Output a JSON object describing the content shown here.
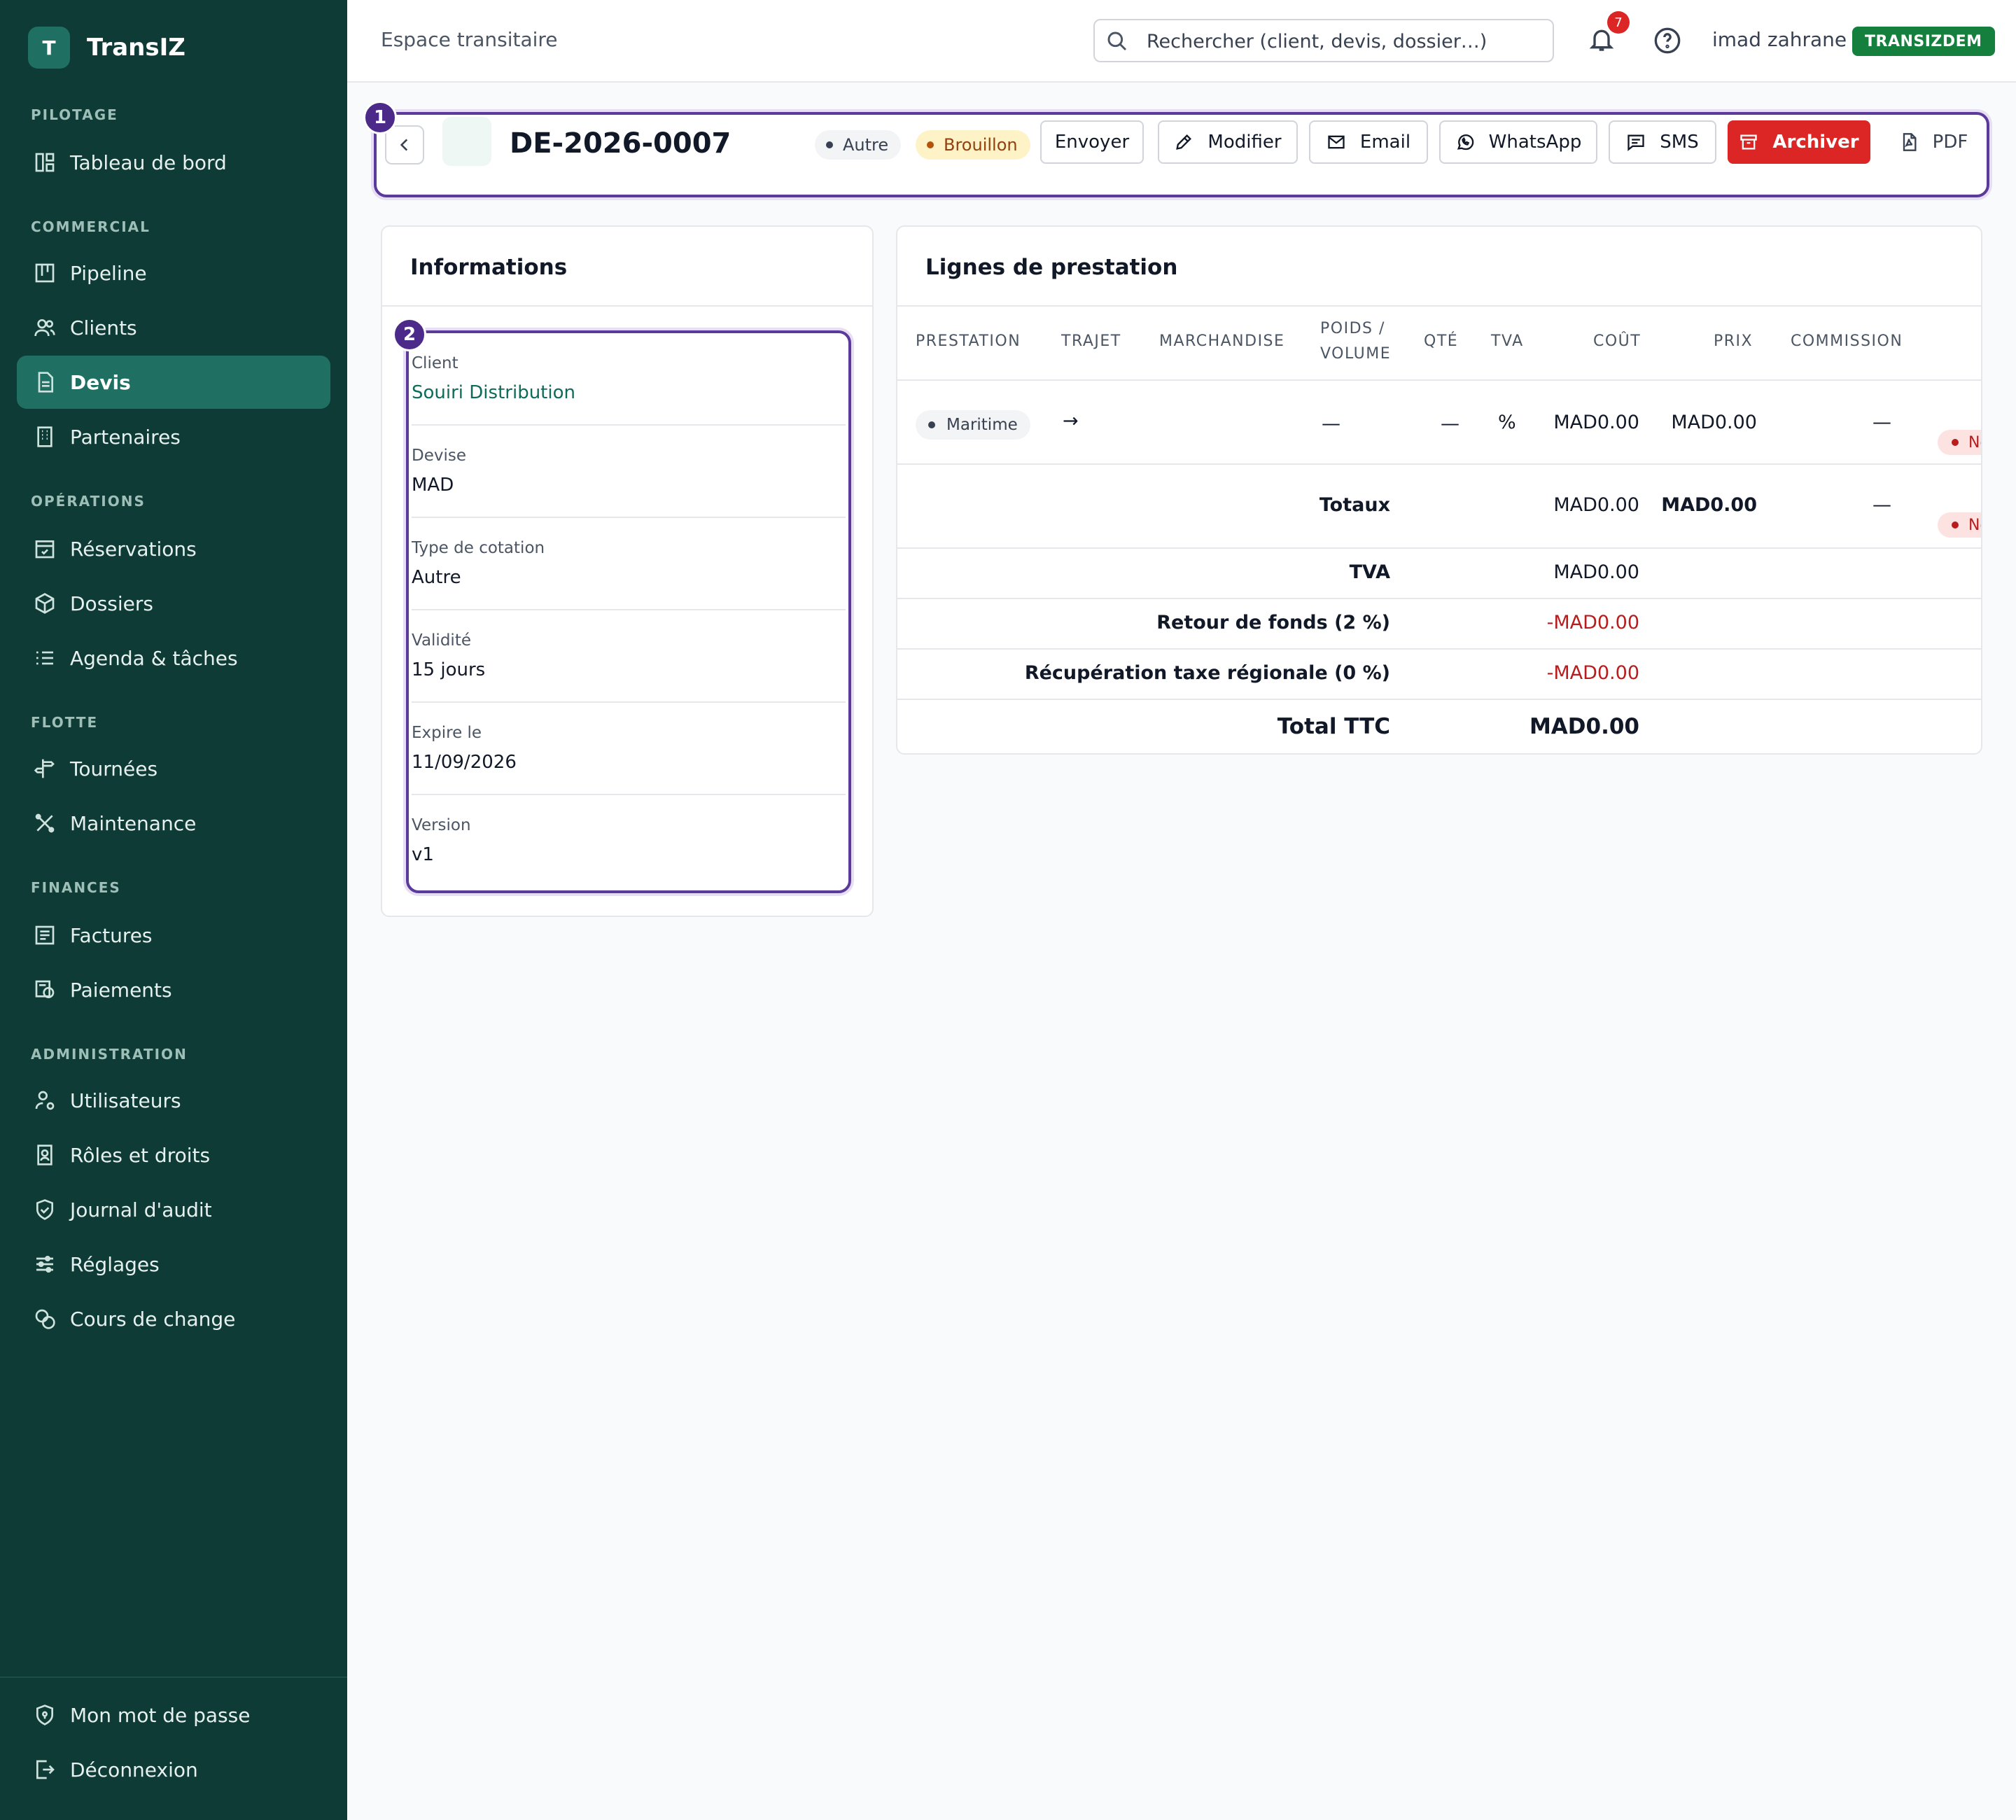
{
  "app": {
    "logo_letter": "T",
    "name": "TransIZ"
  },
  "sidebar": {
    "sections": [
      {
        "title": "PILOTAGE",
        "items": [
          {
            "label": "Tableau de bord",
            "icon": "dashboard-icon"
          }
        ]
      },
      {
        "title": "COMMERCIAL",
        "items": [
          {
            "label": "Pipeline",
            "icon": "kanban-icon"
          },
          {
            "label": "Clients",
            "icon": "users-icon"
          },
          {
            "label": "Devis",
            "icon": "document-icon",
            "active": true
          },
          {
            "label": "Partenaires",
            "icon": "building-icon"
          }
        ]
      },
      {
        "title": "OPÉRATIONS",
        "items": [
          {
            "label": "Réservations",
            "icon": "calendar-check-icon"
          },
          {
            "label": "Dossiers",
            "icon": "package-icon"
          },
          {
            "label": "Agenda & tâches",
            "icon": "list-icon"
          }
        ]
      },
      {
        "title": "FLOTTE",
        "items": [
          {
            "label": "Tournées",
            "icon": "signpost-icon"
          },
          {
            "label": "Maintenance",
            "icon": "tools-icon"
          }
        ]
      },
      {
        "title": "FINANCES",
        "items": [
          {
            "label": "Factures",
            "icon": "receipt-icon"
          },
          {
            "label": "Paiements",
            "icon": "payment-icon"
          }
        ]
      },
      {
        "title": "ADMINISTRATION",
        "items": [
          {
            "label": "Utilisateurs",
            "icon": "user-cog-icon"
          },
          {
            "label": "Rôles et droits",
            "icon": "id-badge-icon"
          },
          {
            "label": "Journal d'audit",
            "icon": "shield-check-icon"
          },
          {
            "label": "Réglages",
            "icon": "sliders-icon"
          },
          {
            "label": "Cours de change",
            "icon": "coins-icon"
          }
        ]
      }
    ],
    "footer": [
      {
        "label": "Mon mot de passe",
        "icon": "shield-lock-icon"
      },
      {
        "label": "Déconnexion",
        "icon": "logout-icon"
      }
    ]
  },
  "topbar": {
    "workspace": "Espace transitaire",
    "search_placeholder": "Rechercher (client, devis, dossier…)",
    "notifications_count": "7",
    "username": "imad zahrane",
    "tenant": "TRANSIZDEM"
  },
  "quote": {
    "marker": "1",
    "number": "DE-2026-0007",
    "type_badge": "Autre",
    "status_badge": "Brouillon",
    "actions": {
      "send": "Envoyer",
      "edit": "Modifier",
      "email": "Email",
      "whatsapp": "WhatsApp",
      "sms": "SMS",
      "archive": "Archiver",
      "pdf": "PDF"
    }
  },
  "info": {
    "title": "Informations",
    "marker": "2",
    "fields": [
      {
        "label": "Client",
        "value": "Souiri Distribution"
      },
      {
        "label": "Devise",
        "value": "MAD"
      },
      {
        "label": "Type de cotation",
        "value": "Autre"
      },
      {
        "label": "Validité",
        "value": "15 jours"
      },
      {
        "label": "Expire le",
        "value": "11/09/2026"
      },
      {
        "label": "Version",
        "value": "v1"
      }
    ]
  },
  "lines": {
    "title": "Lignes de prestation",
    "columns": {
      "service": "PRESTATION",
      "route": "TRAJET",
      "goods": "MARCHANDISE",
      "weight_1": "POIDS /",
      "weight_2": "VOLUME",
      "qty": "QTÉ",
      "vat": "TVA",
      "cost": "COÛT",
      "price": "PRIX",
      "commission": "COMMISSION"
    },
    "row": {
      "service": "Maritime",
      "route": "→",
      "weight": "—",
      "qty": "—",
      "vat": "%",
      "cost": "MAD0.00",
      "price": "MAD0.00",
      "commission": "—",
      "status": "No"
    },
    "totals": {
      "label": "Totaux",
      "cost": "MAD0.00",
      "price": "MAD0.00",
      "commission": "—",
      "status": "No"
    },
    "summary": [
      {
        "label": "TVA",
        "value": "MAD0.00"
      },
      {
        "label": "Retour de fonds (2 %)",
        "value": "-MAD0.00"
      },
      {
        "label": "Récupération taxe régionale (0 %)",
        "value": "-MAD0.00"
      }
    ],
    "total_ttc": {
      "label": "Total TTC",
      "value": "MAD0.00"
    }
  }
}
